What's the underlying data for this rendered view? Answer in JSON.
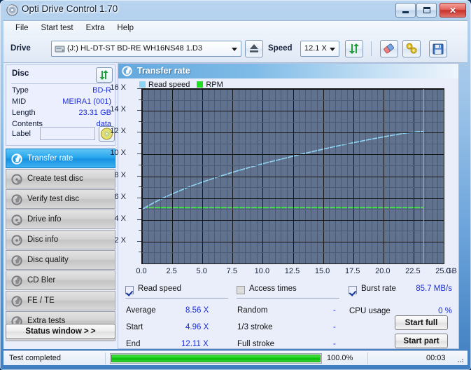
{
  "window": {
    "title": "Opti Drive Control 1.70",
    "icon": "disc-icon",
    "controls": {
      "minimize": "minimize-button",
      "maximize": "maximize-button",
      "close": "✕"
    }
  },
  "menu": {
    "items": [
      "File",
      "Start test",
      "Extra",
      "Help"
    ]
  },
  "toolbar": {
    "drive_label": "Drive",
    "drive_value": "(J:)  HL-DT-ST BD-RE  WH16NS48 1.D3",
    "eject_icon": "eject-icon",
    "speed_label": "Speed",
    "speed_value": "12.1 X",
    "refresh_icon": "refresh-icon",
    "erase_icon": "erase-icon",
    "tools_icon": "tools-icon",
    "save_icon": "save-icon"
  },
  "disc": {
    "title": "Disc",
    "refresh_icon": "refresh-icon",
    "rows": [
      {
        "key": "Type",
        "value": "BD-R"
      },
      {
        "key": "MID",
        "value": "MEIRA1 (001)"
      },
      {
        "key": "Length",
        "value": "23.31 GB"
      },
      {
        "key": "Contents",
        "value": "data"
      }
    ],
    "label_key": "Label",
    "label_value": "",
    "label_placeholder": "",
    "label_button_icon": "disc-icon"
  },
  "sidebar": {
    "items": [
      {
        "label": "Transfer rate",
        "icon": "disc-test-icon",
        "selected": true
      },
      {
        "label": "Create test disc",
        "icon": "disc-test-icon",
        "selected": false
      },
      {
        "label": "Verify test disc",
        "icon": "disc-test-icon",
        "selected": false
      },
      {
        "label": "Drive info",
        "icon": "disc-test-icon",
        "selected": false
      },
      {
        "label": "Disc info",
        "icon": "disc-test-icon",
        "selected": false
      },
      {
        "label": "Disc quality",
        "icon": "disc-test-icon",
        "selected": false
      },
      {
        "label": "CD Bler",
        "icon": "disc-test-icon",
        "selected": false
      },
      {
        "label": "FE / TE",
        "icon": "disc-test-icon",
        "selected": false
      },
      {
        "label": "Extra tests",
        "icon": "disc-test-icon",
        "selected": false
      }
    ],
    "status_window_button": "Status window > >"
  },
  "chart_panel": {
    "header_title": "Transfer rate",
    "header_icon": "disc-test-icon"
  },
  "chart_data": {
    "type": "line",
    "title": "Transfer rate",
    "xlabel": "GB",
    "ylabel": "X",
    "xlim": [
      0.0,
      25.0
    ],
    "ylim": [
      0,
      16
    ],
    "xticks": [
      "0.0",
      "2.5",
      "5.0",
      "7.5",
      "10.0",
      "12.5",
      "15.0",
      "17.5",
      "20.0",
      "22.5",
      "25.0"
    ],
    "xtick_values": [
      0.0,
      2.5,
      5.0,
      7.5,
      10.0,
      12.5,
      15.0,
      17.5,
      20.0,
      22.5,
      25.0
    ],
    "x_unit": "GB",
    "yticks": [
      "2 X",
      "4 X",
      "6 X",
      "8 X",
      "10 X",
      "12 X",
      "14 X",
      "16 X"
    ],
    "ytick_values": [
      2,
      4,
      6,
      8,
      10,
      12,
      14,
      16
    ],
    "grid": true,
    "legend_position": "top-left",
    "plot_background": "#61728f",
    "cursor_x": 23.31,
    "series": [
      {
        "name": "Read speed",
        "color": "#8ed4f2",
        "x": [
          0.0,
          0.6,
          1.3,
          2.1,
          3.0,
          4.0,
          5.2,
          6.4,
          7.7,
          9.0,
          10.4,
          11.8,
          13.2,
          14.6,
          16.0,
          17.4,
          18.8,
          20.2,
          21.6,
          22.6,
          23.31
        ],
        "values": [
          4.96,
          5.35,
          5.76,
          6.18,
          6.62,
          7.07,
          7.54,
          7.98,
          8.43,
          8.84,
          9.26,
          9.64,
          10.02,
          10.38,
          10.73,
          11.05,
          11.36,
          11.65,
          11.92,
          12.05,
          12.11
        ]
      },
      {
        "name": "RPM",
        "color": "#3ff03f",
        "x": [
          0.35,
          23.31
        ],
        "values": [
          5.12,
          5.12
        ]
      }
    ]
  },
  "legend": [
    {
      "label": "Read speed",
      "color": "#8ed4f2"
    },
    {
      "label": "RPM",
      "color": "#22dd22"
    }
  ],
  "stats": {
    "read_speed": {
      "title": "Read speed",
      "checked": true,
      "rows": [
        {
          "key": "Average",
          "value": "8.56 X"
        },
        {
          "key": "Start",
          "value": "4.96 X"
        },
        {
          "key": "End",
          "value": "12.11 X"
        }
      ]
    },
    "access_times": {
      "title": "Access times",
      "checked": false,
      "rows": [
        {
          "key": "Random",
          "value": "-"
        },
        {
          "key": "1/3 stroke",
          "value": "-"
        },
        {
          "key": "Full stroke",
          "value": "-"
        }
      ]
    },
    "burst": {
      "title": "Burst rate",
      "checked": true,
      "value": "85.7 MB/s",
      "cpu_key": "CPU usage",
      "cpu_value": "0 %",
      "start_full": "Start full",
      "start_part": "Start part"
    }
  },
  "statusbar": {
    "text": "Test completed",
    "progress_percent": "100.0%",
    "progress_value": 100,
    "elapsed": "00:03"
  }
}
